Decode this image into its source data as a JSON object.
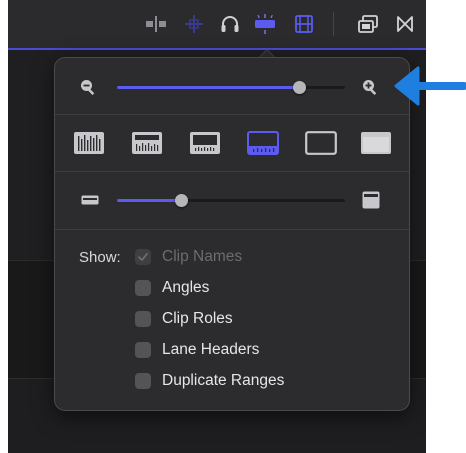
{
  "colors": {
    "accent": "#5b5bf0",
    "arrow": "#1f7fe0",
    "popover_bg": "#2c2c2e",
    "text": "#e6e6e8",
    "disabled_text": "#6c6c70"
  },
  "toolbar": {
    "icons": [
      "snapping-icon",
      "skimming-icon",
      "audio-skimming-icon",
      "solo-icon",
      "clip-appearance-icon",
      "overlap-window-icon",
      "transitions-icon"
    ],
    "active_icon": "clip-appearance-icon"
  },
  "zoom": {
    "level": 0.8,
    "min_icon": "zoom-out-icon",
    "max_icon": "zoom-in-icon"
  },
  "appearance_buttons": [
    {
      "icon": "waveform-large-icon",
      "selected": false
    },
    {
      "icon": "waveform-medium-icon",
      "selected": false
    },
    {
      "icon": "waveform-small-icon",
      "selected": false
    },
    {
      "icon": "filmstrip-waveform-icon",
      "selected": true
    },
    {
      "icon": "filmstrip-only-icon",
      "selected": false
    },
    {
      "icon": "name-only-icon",
      "selected": false
    }
  ],
  "height": {
    "level": 0.28,
    "min_icon": "clip-height-small-icon",
    "max_icon": "clip-height-large-icon"
  },
  "show": {
    "label": "Show:",
    "options": [
      {
        "label": "Clip Names",
        "checked": true,
        "disabled": true
      },
      {
        "label": "Angles",
        "checked": false,
        "disabled": false
      },
      {
        "label": "Clip Roles",
        "checked": false,
        "disabled": false
      },
      {
        "label": "Lane Headers",
        "checked": false,
        "disabled": false
      },
      {
        "label": "Duplicate Ranges",
        "checked": false,
        "disabled": false
      }
    ]
  }
}
